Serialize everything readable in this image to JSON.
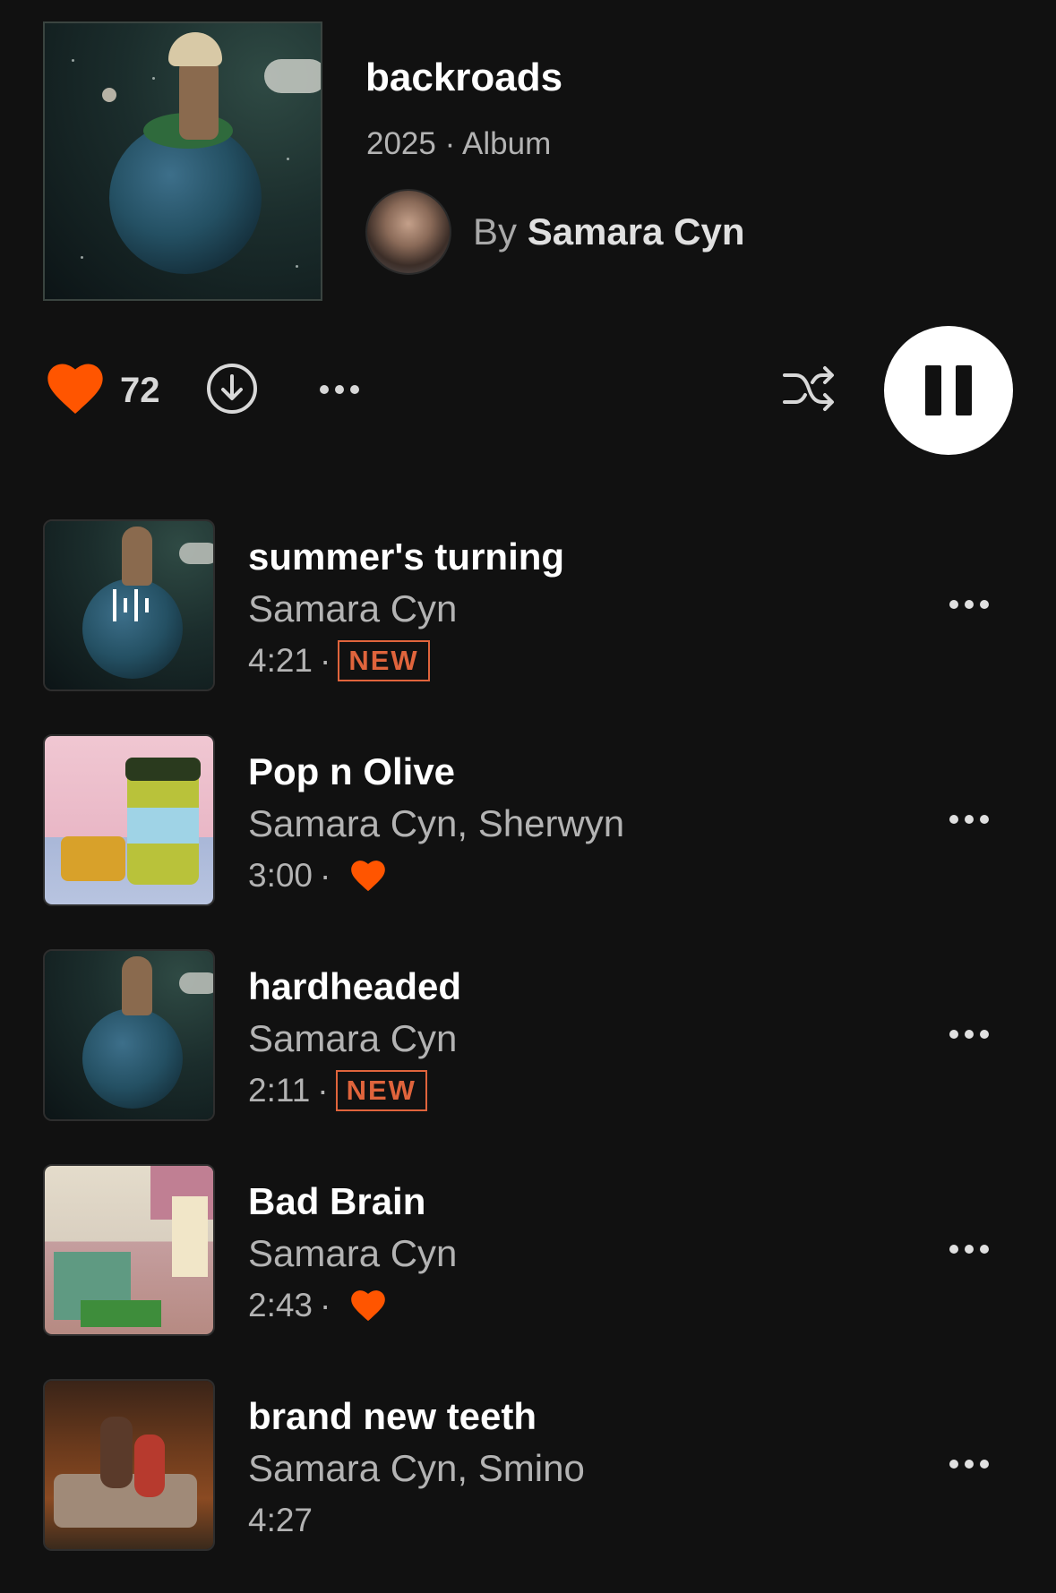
{
  "album": {
    "title": "backroads",
    "meta": "2025 · Album",
    "by_prefix": "By",
    "artist": "Samara Cyn"
  },
  "controls": {
    "like_count": "72",
    "icons": [
      "heart-icon",
      "download-icon",
      "more-icon",
      "shuffle-icon",
      "pause-icon"
    ]
  },
  "tracks": [
    {
      "title": "summer's turning",
      "artists": "Samara Cyn",
      "duration": "4:21",
      "separator": "·",
      "badge": "NEW",
      "liked": false,
      "playing": true
    },
    {
      "title": "Pop n Olive",
      "artists": "Samara Cyn, Sherwyn",
      "duration": "3:00",
      "separator": "·",
      "badge": "",
      "liked": true,
      "playing": false
    },
    {
      "title": "hardheaded",
      "artists": "Samara Cyn",
      "duration": "2:11",
      "separator": "·",
      "badge": "NEW",
      "liked": false,
      "playing": false
    },
    {
      "title": "Bad Brain",
      "artists": "Samara Cyn",
      "duration": "2:43",
      "separator": "·",
      "badge": "",
      "liked": true,
      "playing": false
    },
    {
      "title": "brand new teeth",
      "artists": "Samara Cyn, Smino",
      "duration": "4:27",
      "separator": "",
      "badge": "",
      "liked": false,
      "playing": false
    }
  ],
  "colors": {
    "background": "#111111",
    "accent": "#ff5500",
    "badge": "#e0643c",
    "text_primary": "#ffffff",
    "text_secondary": "#b3b3b3"
  }
}
